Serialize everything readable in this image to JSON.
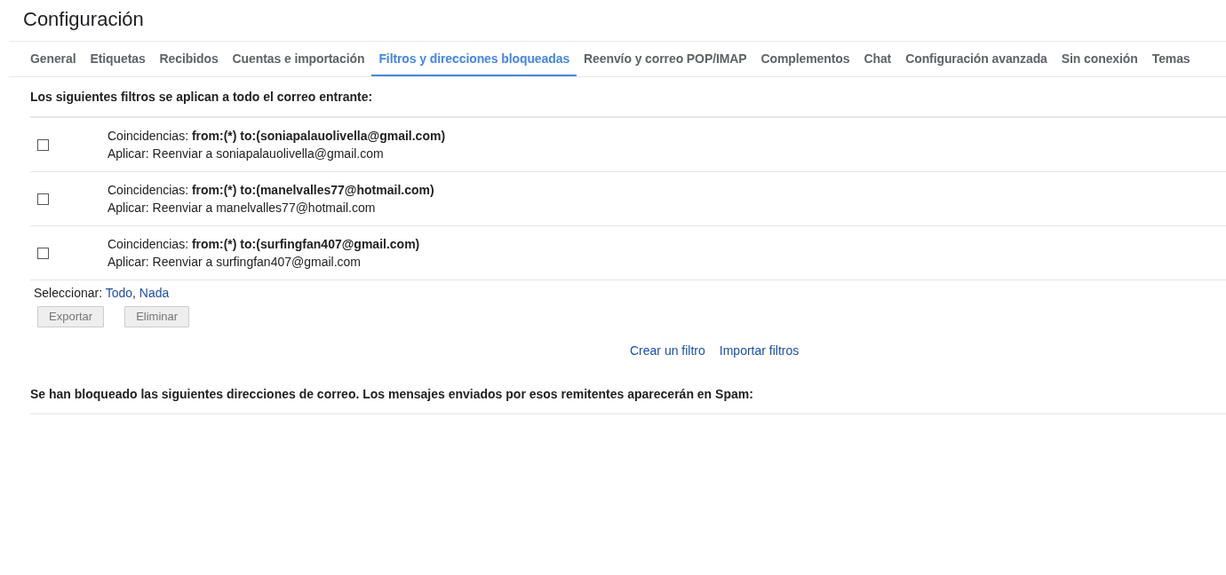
{
  "title": "Configuración",
  "tabs": [
    {
      "label": "General",
      "selected": false
    },
    {
      "label": "Etiquetas",
      "selected": false
    },
    {
      "label": "Recibidos",
      "selected": false
    },
    {
      "label": "Cuentas e importación",
      "selected": false
    },
    {
      "label": "Filtros y direcciones bloqueadas",
      "selected": true
    },
    {
      "label": "Reenvío y correo POP/IMAP",
      "selected": false
    },
    {
      "label": "Complementos",
      "selected": false
    },
    {
      "label": "Chat",
      "selected": false
    },
    {
      "label": "Configuración avanzada",
      "selected": false
    },
    {
      "label": "Sin conexión",
      "selected": false
    },
    {
      "label": "Temas",
      "selected": false
    }
  ],
  "filters_heading": "Los siguientes filtros se aplican a todo el correo entrante:",
  "filters": [
    {
      "checked": false,
      "match_label": "Coincidencias:",
      "match_criteria": "from:(*) to:(soniapalauolivella@gmail.com)",
      "action": "Aplicar: Reenviar a soniapalauolivella@gmail.com"
    },
    {
      "checked": false,
      "match_label": "Coincidencias:",
      "match_criteria": "from:(*) to:(manelvalles77@hotmail.com)",
      "action": "Aplicar: Reenviar a manelvalles77@hotmail.com"
    },
    {
      "checked": false,
      "match_label": "Coincidencias:",
      "match_criteria": "from:(*) to:(surfingfan407@gmail.com)",
      "action": "Aplicar: Reenviar a surfingfan407@gmail.com"
    }
  ],
  "select_label": "Seleccionar:",
  "select_links": [
    "Todo",
    "Nada"
  ],
  "select_separator": ",",
  "buttons": [
    {
      "label": "Exportar",
      "disabled": true
    },
    {
      "label": "Eliminar",
      "disabled": true
    }
  ],
  "links": [
    "Crear un filtro",
    "Importar filtros"
  ],
  "blocked_heading": "Se han bloqueado las siguientes direcciones de correo. Los mensajes enviados por esos remitentes aparecerán en Spam:"
}
